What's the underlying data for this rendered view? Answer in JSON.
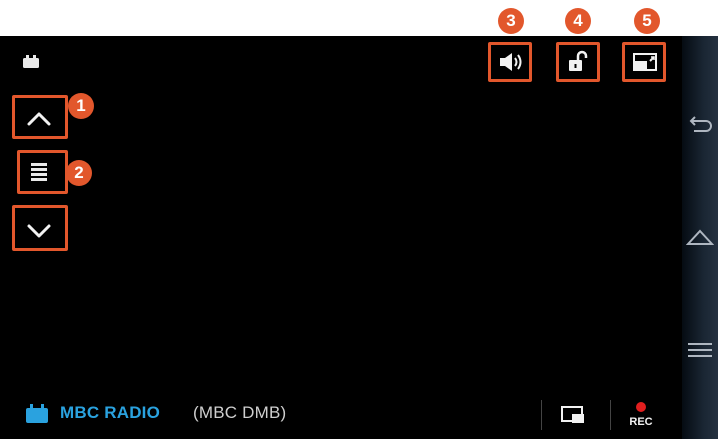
{
  "annotations": {
    "badge_1": "1",
    "badge_2": "2",
    "badge_3": "3",
    "badge_4": "4",
    "badge_5": "5"
  },
  "channel": {
    "name": "MBC RADIO",
    "sub": "(MBC DMB)"
  },
  "record": {
    "label": "REC"
  },
  "colors": {
    "accent_blue": "#2aa2df",
    "annotation_red": "#e2572c",
    "rec_red": "#e01e1e"
  },
  "icons": {
    "top_left": "battery-icon",
    "volume": "volume-icon",
    "lock": "unlock-icon",
    "screen": "screen-mode-icon",
    "up": "chevron-up-icon",
    "list": "list-icon",
    "down": "chevron-down-icon",
    "back": "back-icon",
    "home": "home-icon",
    "menu": "menu-icon",
    "channel": "tv-icon",
    "pip": "pip-icon"
  }
}
